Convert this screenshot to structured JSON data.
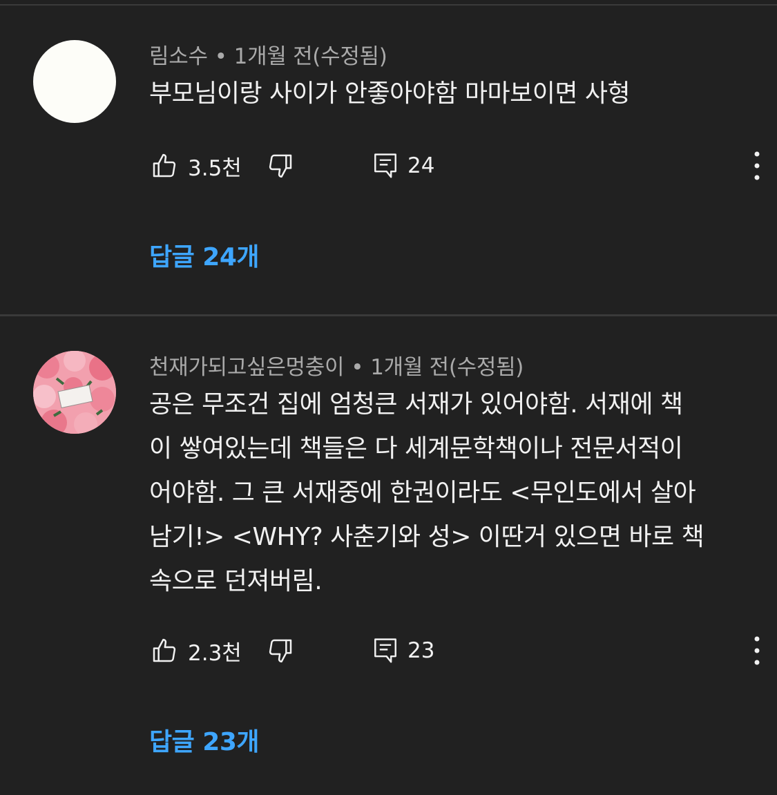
{
  "comments": [
    {
      "author": "림소수",
      "time": "1개월 전(수정됨)",
      "separator": "•",
      "text_lines": [
        "부모님이랑 사이가 안좋아야함 마마보이면 사형"
      ],
      "likes": "3.5천",
      "reply_count": "24",
      "replies_label": "답글 24개",
      "avatar_color": "#fdfdf8"
    },
    {
      "author": "천재가되고싶은멍충이",
      "time": "1개월 전(수정됨)",
      "separator": "•",
      "text_lines": [
        "공은 무조건 집에 엄청큰 서재가 있어야함. 서재에 책",
        "이 쌓여있는데 책들은 다 세계문학책이나 전문서적이",
        "어야함. 그 큰 서재중에 한권이라도 <무인도에서 살아",
        "남기!> <WHY? 사춘기와 성> 이딴거 있으면 바로 책",
        "속으로 던져버림."
      ],
      "likes": "2.3천",
      "reply_count": "23",
      "replies_label": "답글 23개",
      "avatar_color": "#f29aa8"
    }
  ],
  "icons": {
    "like": "thumbs-up-icon",
    "dislike": "thumbs-down-icon",
    "reply": "comment-icon",
    "more": "more-vert-icon"
  },
  "colors": {
    "background": "#212121",
    "text": "#f1f1f1",
    "meta": "#aaaaaa",
    "link": "#3ea6ff",
    "divider": "#3a3a3a"
  }
}
